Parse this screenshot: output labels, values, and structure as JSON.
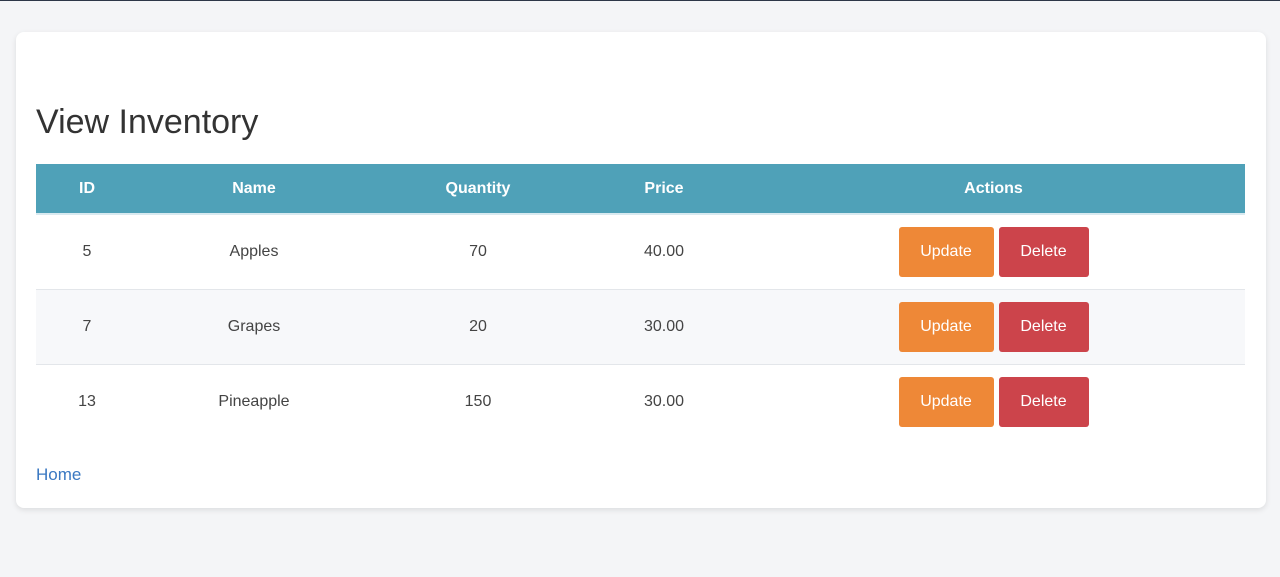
{
  "page": {
    "title": "View Inventory",
    "home_link": "Home"
  },
  "table": {
    "headers": [
      "ID",
      "Name",
      "Quantity",
      "Price",
      "Actions"
    ],
    "rows": [
      {
        "id": "5",
        "name": "Apples",
        "quantity": "70",
        "price": "40.00",
        "update_label": "Update",
        "delete_label": "Delete"
      },
      {
        "id": "7",
        "name": "Grapes",
        "quantity": "20",
        "price": "30.00",
        "update_label": "Update",
        "delete_label": "Delete"
      },
      {
        "id": "13",
        "name": "Pineapple",
        "quantity": "150",
        "price": "30.00",
        "update_label": "Update",
        "delete_label": "Delete"
      }
    ]
  },
  "colors": {
    "header_bg": "#4fa1b8",
    "update_button": "#ee8837",
    "delete_button": "#cc444b",
    "link": "#3a78c2",
    "page_bg": "#f4f5f7"
  }
}
